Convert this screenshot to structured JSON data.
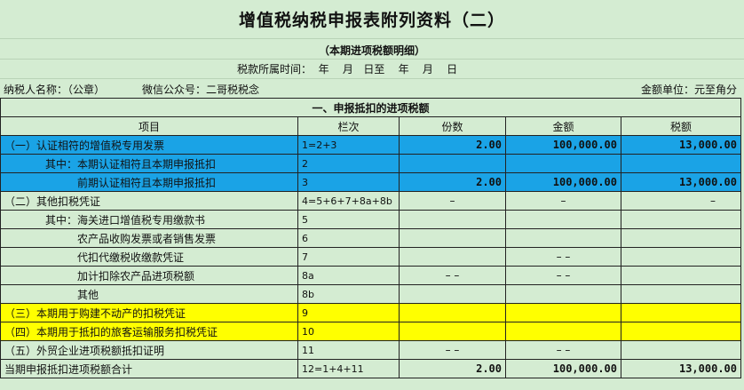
{
  "title": "增值税纳税申报表附列资料（二）",
  "subtitle": "（本期进项税额明细）",
  "period": "税款所属时间：  年    月   日至    年    月    日",
  "taxpayer": "纳税人名称：（公章）",
  "wechat": "微信公众号：二哥税税念",
  "unit": "金额单位：元至角分",
  "section1": "一、申报抵扣的进项税额",
  "headers": [
    "项目",
    "栏次",
    "份数",
    "金额",
    "税额"
  ],
  "rows": [
    {
      "item": "（一）认证相符的增值税专用发票",
      "line": "1=2+3",
      "count": "2.00",
      "amount": "100,000.00",
      "tax": "13,000.00"
    },
    {
      "item": "其中：本期认证相符且本期申报抵扣",
      "line": "2",
      "count": "",
      "amount": "",
      "tax": ""
    },
    {
      "item": "前期认证相符且本期申报抵扣",
      "line": "3",
      "count": "2.00",
      "amount": "100,000.00",
      "tax": "13,000.00"
    },
    {
      "item": "（二）其他扣税凭证",
      "line": "4=5+6+7+8a+8b",
      "count": "–",
      "amount": "–",
      "tax": "–"
    },
    {
      "item": "其中：海关进口增值税专用缴款书",
      "line": "5",
      "count": "",
      "amount": "",
      "tax": ""
    },
    {
      "item": "农产品收购发票或者销售发票",
      "line": "6",
      "count": "",
      "amount": "",
      "tax": ""
    },
    {
      "item": "代扣代缴税收缴款凭证",
      "line": "7",
      "count": "",
      "amount": "– –",
      "tax": ""
    },
    {
      "item": "加计扣除农产品进项税额",
      "line": "8a",
      "count": "– –",
      "amount": "– –",
      "tax": ""
    },
    {
      "item": "其他",
      "line": "8b",
      "count": "",
      "amount": "",
      "tax": ""
    },
    {
      "item": "（三）本期用于购建不动产的扣税凭证",
      "line": "9",
      "count": "",
      "amount": "",
      "tax": ""
    },
    {
      "item": "（四）本期用于抵扣的旅客运输服务扣税凭证",
      "line": "10",
      "count": "",
      "amount": "",
      "tax": ""
    },
    {
      "item": "（五）外贸企业进项税额抵扣证明",
      "line": "11",
      "count": "– –",
      "amount": "– –",
      "tax": ""
    },
    {
      "item": "当期申报抵扣进项税额合计",
      "line": "12=1+4+11",
      "count": "2.00",
      "amount": "100,000.00",
      "tax": "13,000.00"
    }
  ],
  "colors": {
    "highlight_blue": "#1aa3e6",
    "highlight_yellow": "#ffff00",
    "sheet_green": "#d4ecd2"
  }
}
